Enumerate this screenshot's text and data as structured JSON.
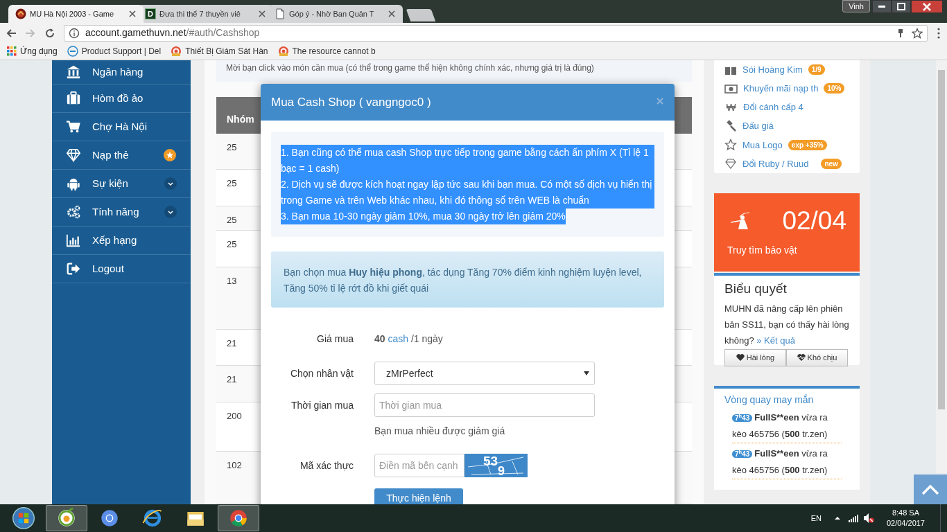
{
  "browser": {
    "tabs": [
      {
        "title": "MU Hà Nội 2003 - Game",
        "selected": true
      },
      {
        "title": "Đưa thi thể 7 thuyền viê",
        "favicon_text": "D",
        "selected": false
      },
      {
        "title": "Góp ý - Nhờ Ban Quản T",
        "selected": false
      }
    ],
    "profile": "Vinh",
    "url_host": "account.gamethuvn.net",
    "url_path": "/#auth/Cashshop",
    "bookmarks": [
      {
        "label": "Ứng dụng"
      },
      {
        "label": "Product Support | Del"
      },
      {
        "label": "Thiết Bị Giám Sát Hàn"
      },
      {
        "label": "The resource cannot b"
      }
    ]
  },
  "sidebar": {
    "items": [
      {
        "label": "Ngân hàng",
        "kind": "plain"
      },
      {
        "label": "Hòm đồ ảo",
        "kind": "plain"
      },
      {
        "label": "Chợ Hà Nội",
        "kind": "plain"
      },
      {
        "label": "Nạp thẻ",
        "kind": "featured"
      },
      {
        "label": "Sự kiện",
        "kind": "submenu"
      },
      {
        "label": "Tính năng",
        "kind": "submenu"
      },
      {
        "label": "Xếp hạng",
        "kind": "plain"
      },
      {
        "label": "Logout",
        "kind": "plain"
      }
    ]
  },
  "notice": "Mời bạn click vào món cần mua (có thể trong game thể hiện không chính xác, nhưng giá trị là đúng)",
  "table": {
    "columns": [
      "Nhóm"
    ],
    "rows": [
      [
        "25"
      ],
      [
        "25"
      ],
      [
        "25"
      ],
      [
        "25"
      ],
      [
        "13"
      ],
      [
        "21"
      ],
      [
        "21"
      ],
      [
        "200"
      ],
      [
        "102"
      ]
    ]
  },
  "modal": {
    "title": "Mua Cash Shop ( vangngoc0 )",
    "instructions": {
      "highlighted": true,
      "lines": [
        "1. Bạn cũng có thể mua cash Shop trực tiếp trong game bằng cách ấn phím X (Tỉ lệ 1 bạc = 1 cash)",
        "2. Dịch vụ sẽ được kích hoạt ngay lập tức sau khi bạn mua. Có một số dịch vụ hiển thị trong Game và trên Web khác nhau, khi đó thông số trên WEB là chuẩn",
        "3. Bạn mua 10-30 ngày giảm 10%, mua 30 ngày trở lên giảm 20%"
      ]
    },
    "alert": "Bạn chọn mua **Huy hiệu phong**, tác dụng Tăng 70% điểm kinh nghiệm luyện level, Tăng 50% tỉ lệ rớt đồ khi giết quái",
    "fields": [
      {
        "kind": "price",
        "label": "Giá mua",
        "amount": "40",
        "currency": "cash",
        "per": "/1 ngày"
      },
      {
        "kind": "select",
        "label": "Chọn nhân vật",
        "value": "zMrPerfect"
      },
      {
        "kind": "input",
        "label": "Thời gian mua",
        "placeholder": "Thời gian mua",
        "help": "Bạn mua nhiều được giảm giá"
      },
      {
        "kind": "captcha",
        "label": "Mã xác thực",
        "placeholder": "Điền mã bên cạnh",
        "captcha": [
          "53",
          "9"
        ]
      }
    ],
    "submit": "Thực hiện lệnh"
  },
  "right": {
    "links": [
      {
        "label": "Sói Hoàng Kim",
        "badge": "1/9"
      },
      {
        "label": "Khuyến mãi nạp th",
        "badge": "10%"
      },
      {
        "label": "Đổi cánh cấp 4",
        "glyph": "₩"
      },
      {
        "label": "Đấu giá"
      },
      {
        "label": "Mua Logo",
        "badge": "exp +35%"
      },
      {
        "label": "Đổi Ruby / Ruud",
        "badge": "new"
      }
    ],
    "event": {
      "date": "02/04",
      "label": "Truy tìm bảo vật"
    },
    "poll": {
      "title": "Biểu quyết",
      "question": "MUHN đã nâng cấp lên phiên bản SS11, bạn có thấy hài lòng không?",
      "results_link": "» Kết quả",
      "buttons": [
        {
          "label": "Hài lòng"
        },
        {
          "label": "Khó chịu"
        }
      ]
    },
    "wheel": {
      "title": "Vòng quay may mắn",
      "entries": [
        {
          "time": "7$^{h}$43",
          "user": "FullS**een",
          "action": " vừa ra kèo 465756 (",
          "amount": "500",
          "unit": " tr.zen)"
        },
        {
          "time": "7$^{h}$43",
          "user": "FullS**een",
          "action": " vừa ra kèo 465756 (",
          "amount": "500",
          "unit": " tr.zen)"
        }
      ]
    }
  },
  "taskbar": {
    "apps": [
      {
        "running": false
      },
      {
        "running": true
      },
      {
        "running": false
      },
      {
        "running": false
      },
      {
        "running": false
      },
      {
        "running": true
      }
    ],
    "language": "EN",
    "time": "8:48 SA",
    "date": "02/04/2017"
  }
}
